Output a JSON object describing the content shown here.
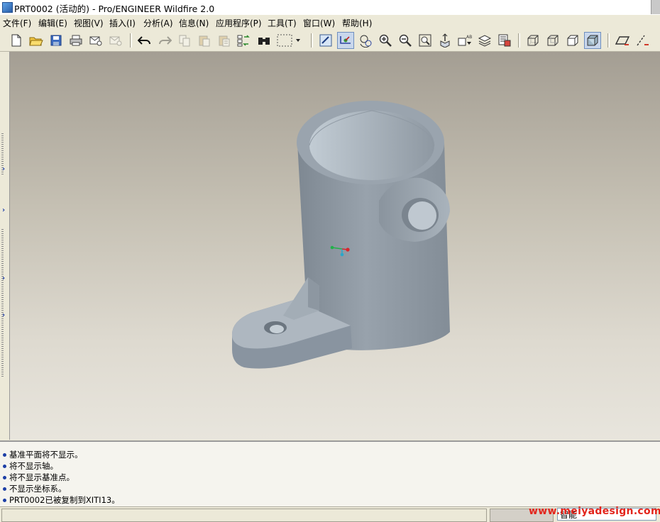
{
  "window": {
    "title": "PRT0002 (活动的) - Pro/ENGINEER Wildfire 2.0"
  },
  "menu": [
    {
      "label": "文件(F)"
    },
    {
      "label": "编辑(E)"
    },
    {
      "label": "视图(V)"
    },
    {
      "label": "插入(I)"
    },
    {
      "label": "分析(A)"
    },
    {
      "label": "信息(N)"
    },
    {
      "label": "应用程序(P)"
    },
    {
      "label": "工具(T)"
    },
    {
      "label": "窗口(W)"
    },
    {
      "label": "帮助(H)"
    }
  ],
  "toolbar": {
    "buttons": [
      {
        "name": "new-icon",
        "enabled": true
      },
      {
        "name": "open-icon",
        "enabled": true
      },
      {
        "name": "save-icon",
        "enabled": true
      },
      {
        "name": "print-icon",
        "enabled": true
      },
      {
        "name": "email-icon",
        "enabled": true
      },
      {
        "name": "email-link-icon",
        "enabled": false
      },
      {
        "name": "undo-icon",
        "enabled": true
      },
      {
        "name": "redo-icon",
        "enabled": false
      },
      {
        "name": "copy-icon",
        "enabled": false
      },
      {
        "name": "paste-icon",
        "enabled": false
      },
      {
        "name": "paste-special-icon",
        "enabled": false
      },
      {
        "name": "regenerate-icon",
        "enabled": true
      },
      {
        "name": "find-icon",
        "enabled": true
      },
      {
        "name": "select-box-icon",
        "enabled": true
      },
      {
        "name": "repaint-icon",
        "enabled": true
      },
      {
        "name": "spin-center-icon",
        "enabled": true,
        "active": true
      },
      {
        "name": "orient-mode-icon",
        "enabled": true
      },
      {
        "name": "zoom-in-icon",
        "enabled": true
      },
      {
        "name": "zoom-out-icon",
        "enabled": true
      },
      {
        "name": "refit-icon",
        "enabled": true
      },
      {
        "name": "reorient-icon",
        "enabled": true
      },
      {
        "name": "saved-views-icon",
        "enabled": true
      },
      {
        "name": "layers-icon",
        "enabled": true
      },
      {
        "name": "view-manager-icon",
        "enabled": true
      },
      {
        "name": "wireframe-icon",
        "enabled": true
      },
      {
        "name": "hidden-line-icon",
        "enabled": true
      },
      {
        "name": "no-hidden-icon",
        "enabled": true
      },
      {
        "name": "shading-icon",
        "enabled": true,
        "active": true
      },
      {
        "name": "datum-planes-icon",
        "enabled": true
      },
      {
        "name": "datum-axes-icon",
        "enabled": true
      }
    ]
  },
  "messages": [
    {
      "text": "基准平面将不显示。"
    },
    {
      "text": "将不显示轴。"
    },
    {
      "text": "将不显示基准点。"
    },
    {
      "text": "不显示坐标系。"
    },
    {
      "text": "PRT0002已被复制到XITI13。"
    }
  ],
  "statusbar": {
    "filter_value": "智能"
  },
  "watermark": "www.meiyadesign.com",
  "colors": {
    "model_face": "#8d96a0",
    "viewport_top": "#a49e93",
    "viewport_bottom": "#e8e5dd",
    "bullet": "#1c3ea6",
    "watermark": "#e3241b"
  }
}
